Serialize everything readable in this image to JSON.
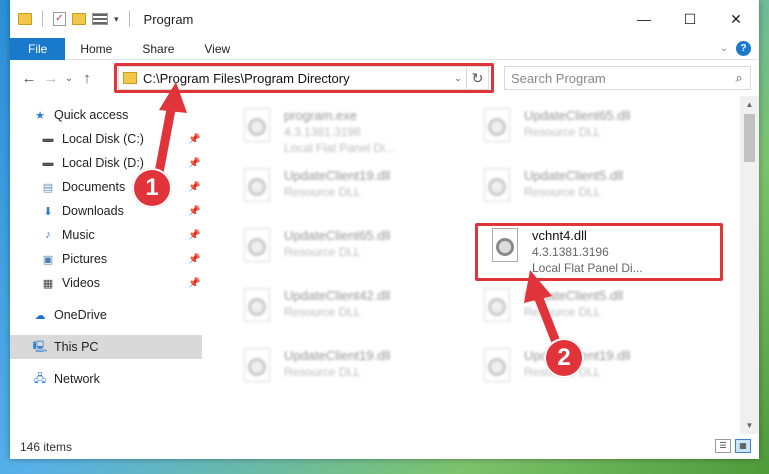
{
  "window": {
    "title": "Program",
    "controls": {
      "minimize": "—",
      "maximize": "☐",
      "close": "✕"
    }
  },
  "ribbon": {
    "tabs": [
      "File",
      "Home",
      "Share",
      "View"
    ],
    "help": "?",
    "collapse": "⌄"
  },
  "nav": {
    "back": "←",
    "forward": "→",
    "recent": "⌄",
    "up": "↑",
    "address": "C:\\Program Files\\Program Directory",
    "address_dropdown": "⌄",
    "refresh": "↻",
    "search_placeholder": "Search Program",
    "search_icon": "⌕"
  },
  "sidebar": {
    "items": [
      {
        "label": "Quick access",
        "icon": "star-icon",
        "pinned": false
      },
      {
        "label": "Local Disk (C:)",
        "icon": "drive-icon",
        "pinned": true
      },
      {
        "label": "Local Disk (D:)",
        "icon": "drive-icon",
        "pinned": true
      },
      {
        "label": "Documents",
        "icon": "document-icon",
        "pinned": true
      },
      {
        "label": "Downloads",
        "icon": "download-icon",
        "pinned": true
      },
      {
        "label": "Music",
        "icon": "music-icon",
        "pinned": true
      },
      {
        "label": "Pictures",
        "icon": "picture-icon",
        "pinned": true
      },
      {
        "label": "Videos",
        "icon": "video-icon",
        "pinned": true
      },
      {
        "label": "OneDrive",
        "icon": "cloud-icon",
        "pinned": false
      },
      {
        "label": "This PC",
        "icon": "computer-icon",
        "pinned": false,
        "selected": true
      },
      {
        "label": "Network",
        "icon": "network-icon",
        "pinned": false
      }
    ],
    "pin_glyph": "📌"
  },
  "files": [
    {
      "name": "program.exe",
      "line1": "4.3.1381.3196",
      "line2": "Local Flat Panel Di...",
      "blurred": true
    },
    {
      "name": "UpdateClient65.dll",
      "line1": "Resource DLL",
      "line2": "",
      "blurred": true
    },
    {
      "name": "UpdateClient19.dll",
      "line1": "Resource DLL",
      "line2": "",
      "blurred": true
    },
    {
      "name": "UpdateClient5.dll",
      "line1": "Resource DLL",
      "line2": "",
      "blurred": true
    },
    {
      "name": "UpdateClient65.dll",
      "line1": "Resource DLL",
      "line2": "",
      "blurred": true
    },
    {
      "name": "vchnt4.dll",
      "line1": "4.3.1381.3196",
      "line2": "Local Flat Panel Di...",
      "blurred": false
    },
    {
      "name": "UpdateClient42.dll",
      "line1": "Resource DLL",
      "line2": "",
      "blurred": true
    },
    {
      "name": "UpdateClient5.dll",
      "line1": "Resource DLL",
      "line2": "",
      "blurred": true
    },
    {
      "name": "UpdateClient19.dll",
      "line1": "Resource DLL",
      "line2": "",
      "blurred": true
    },
    {
      "name": "UpdateClient19.dll",
      "line1": "Resource DLL",
      "line2": "",
      "blurred": true
    }
  ],
  "status": {
    "count": "146 items"
  },
  "callouts": [
    {
      "number": "1"
    },
    {
      "number": "2"
    }
  ],
  "colors": {
    "accent": "#1979ca",
    "highlight": "#e0333a"
  }
}
